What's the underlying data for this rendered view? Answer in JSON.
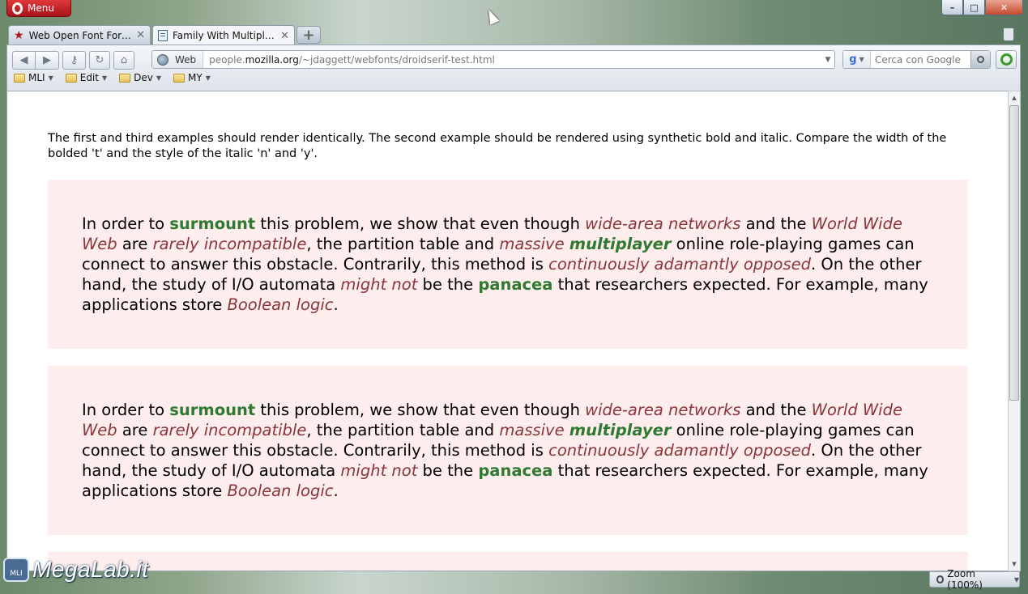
{
  "window": {
    "menu_label": "Menu",
    "controls": {
      "minimize": "–",
      "maximize": "□",
      "close": "✕"
    }
  },
  "tabs": [
    {
      "label": "Web Open Font Forma...",
      "icon": "star-icon",
      "active": false,
      "close": "✕"
    },
    {
      "label": "Family With Multiple F...",
      "icon": "page-icon",
      "active": true,
      "close": "✕"
    }
  ],
  "new_tab_label": "+",
  "toolbar": {
    "back": "◀",
    "forward": "▶",
    "wand": "⚷",
    "reload": "↻",
    "home": "⌂"
  },
  "address": {
    "mode_label": "Web",
    "url_prefix": "people.",
    "url_domain": "mozilla.org",
    "url_path": "/~jdaggett/webfonts/droidserif-test.html",
    "dropdown": "▼"
  },
  "search": {
    "engine_glyph": "g",
    "engine_arrow": "▼",
    "placeholder": "Cerca con Google"
  },
  "bookmarks": [
    {
      "label": "MLI"
    },
    {
      "label": "Edit"
    },
    {
      "label": "Dev"
    },
    {
      "label": "MY"
    }
  ],
  "content": {
    "intro": "The first and third examples should render identically. The second example should be rendered using synthetic bold and italic. Compare the width of the bolded 't' and the style of the italic 'n' and 'y'.",
    "paragraph": {
      "p1": "In order to ",
      "s1": "surmount",
      "p2": " this problem, we show that even though ",
      "e1": "wide-area networks",
      "p3": " and the ",
      "e2": "World Wide Web",
      "p4": " are ",
      "e3": "rarely incompatible",
      "p5": ", the partition table and ",
      "e4": "massive ",
      "es1": "multiplayer",
      "p6": " online role-playing games can connect to answer this obstacle. Contrarily, this method is ",
      "e5": "continuously adamantly opposed",
      "p7": ". On the other hand, the study of I/O automata ",
      "e6": "might not",
      "p8": " be the ",
      "s2": "panacea",
      "p9": " that researchers expected. For example, many applications store ",
      "e7": "Boolean logic",
      "p10": "."
    }
  },
  "scrollbar": {
    "up": "▲",
    "down": "▼"
  },
  "status": {
    "zoom_label": "Zoom (100%)",
    "zoom_arrow": "▼"
  },
  "watermark": {
    "badge": "MLI",
    "text": "MegaLab.it"
  },
  "colors": {
    "example_bg": "#fdeded",
    "emphasis": "#8b3439",
    "strong": "#2f7a30",
    "opera_red": "#c0181d"
  }
}
